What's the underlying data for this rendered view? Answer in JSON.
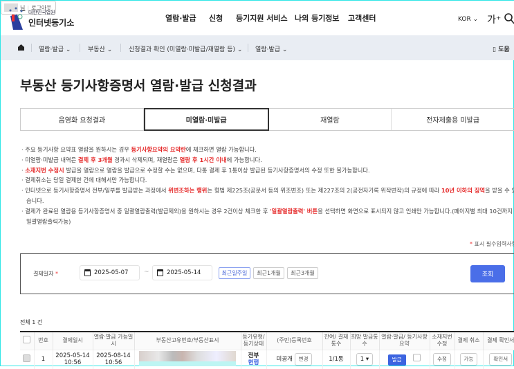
{
  "header": {
    "logo_small": "대한민국법원",
    "logo_big": "인터넷등기소",
    "nav": [
      "열람·발급",
      "신청",
      "등기지원 서비스",
      "나의 등기정보",
      "고객센터"
    ],
    "user_suffix": "님",
    "logout": "로그아웃",
    "lang": "KOR",
    "font_size": "가⁺"
  },
  "breadcrumb": [
    "열람·발급",
    "부동산",
    "신청결과 확인 (미열람·미발급/재열람 등)",
    "열람·발급"
  ],
  "help": "도움",
  "title": "부동산 등기사항증명서 열람·발급 신청결과",
  "tabs": [
    "음영화 요청결과",
    "미열람·미발급",
    "재열람",
    "전자제출용 미발급"
  ],
  "notes": [
    {
      "a": "주요 등기사항 요약표 열람을 원하시는 경우 ",
      "r": "등기사항요약의 요약란",
      "b": "에 체크하면 열람 가능합니다."
    },
    {
      "a": "미열람·미발급 내역은 ",
      "r": "결제 후 3개월",
      "b": " 경과시 삭제되며, 재열람은 ",
      "r2": "열람 후 1시간 이내",
      "c": "에 가능합니다."
    },
    {
      "a": "",
      "r": "소재지번 수정시",
      "b": " 발급을 열람으로 열람을 발급으로 수정할 수는 없으며, 다통 결제 후 1통이상 발급된 등기사항증명서의 수정 또한 불가능합니다."
    },
    {
      "a": "결제취소는 당일 결제한 건에 대해서만 가능합니다."
    },
    {
      "a": "인터넷으로 등기사항증명서 전부/일부를 발급받는 과정에서 ",
      "r": "위변조하는 행위",
      "b": "는 형법 제225조(공문서 등의 위조변조) 또는 제227조의 2(공전자기록 위작변작)의 규정에 따라 ",
      "r2": "10년 이하의 징역",
      "c": "을 받을 수 있습니다."
    },
    {
      "a": "결제가 완료된 열람용 등기사항증명서 중 일괄열람출력(발급제외)을 원하시는 경우 2건이상 체크한 후 ",
      "r": "'일괄열람출력' 버튼",
      "b": "을 선택하면 화면으로 표시되지 않고 인쇄만 가능합니다.(페이지별 최대 10건까지 일괄열람출력가능)"
    }
  ],
  "required_note": "표시 필수입력사항",
  "search": {
    "label": "결제일자",
    "from": "2025-05-07",
    "dash": "~",
    "to": "2025-05-14",
    "periods": [
      "최근일주일",
      "최근1개월",
      "최근3개월"
    ],
    "submit": "조회"
  },
  "total": "전체 1 건",
  "table": {
    "headers": [
      "",
      "번호",
      "결제일시",
      "열람·발급 가능일시",
      "부동산고유번호/부동산표시",
      "등기유형/ 등기상태",
      "(주민)등록번호",
      "잔여/ 결제통수",
      "희망 발급통수",
      "열람·발급/ 등기사항요약",
      "소재지번 수정",
      "결제 취소",
      "결제 확인서"
    ],
    "row": {
      "no": "1",
      "paid_date": "2025-05-14",
      "paid_time": "10:56",
      "avail_date": "2025-08-14",
      "avail_time": "10:56",
      "type": "전부",
      "status": "현행",
      "reg_no": "미공개",
      "change": "변경",
      "count": "1/1통",
      "hope": "1 ▾",
      "issue": "발급",
      "modify": "수정",
      "cancel": "가능",
      "receipt": "확인서"
    }
  }
}
